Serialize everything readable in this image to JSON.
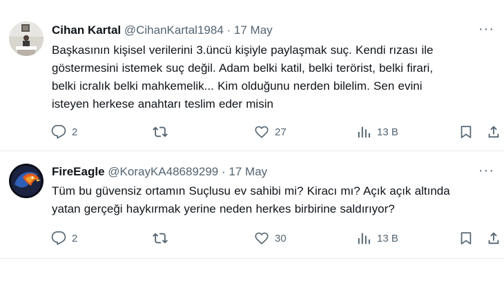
{
  "tweets": [
    {
      "name": "Cihan Kartal",
      "handle": "@CihanKartal1984",
      "separator": "·",
      "date": "17 May",
      "more": "···",
      "lines": [
        "Başkasının kişisel verilerini 3.üncü kişiyle paylaşmak suç.  Kendi rızası ile",
        "göstermesini istemek suç değil.  Adam  belki katil, belki terörist, belki firari,",
        "belki icralık belki mahkemelik... Kim olduğunu nerden bilelim. Sen evini",
        "isteyen herkese anahtarı teslim eder misin"
      ],
      "replies": "2",
      "retweets": "",
      "likes": "27",
      "views": "13 B"
    },
    {
      "name": "FireEagle",
      "handle": "@KorayKA48689299",
      "separator": "·",
      "date": "17 May",
      "more": "···",
      "lines": [
        "Tüm bu güvensiz ortamın Suçlusu ev sahibi mi? Kiracı mı? Açık açık altında",
        "yatan gerçeği haykırmak yerine neden herkes birbirine saldırıyor?"
      ],
      "replies": "2",
      "retweets": "",
      "likes": "30",
      "views": "13 B"
    }
  ],
  "icons": {
    "reply": "reply-icon",
    "retweet": "retweet-icon",
    "like": "heart-icon",
    "views": "views-icon",
    "bookmark": "bookmark-icon",
    "share": "share-icon"
  },
  "colors": {
    "text": "#0f1419",
    "secondary": "#536471",
    "divider": "#e6e9ec"
  }
}
